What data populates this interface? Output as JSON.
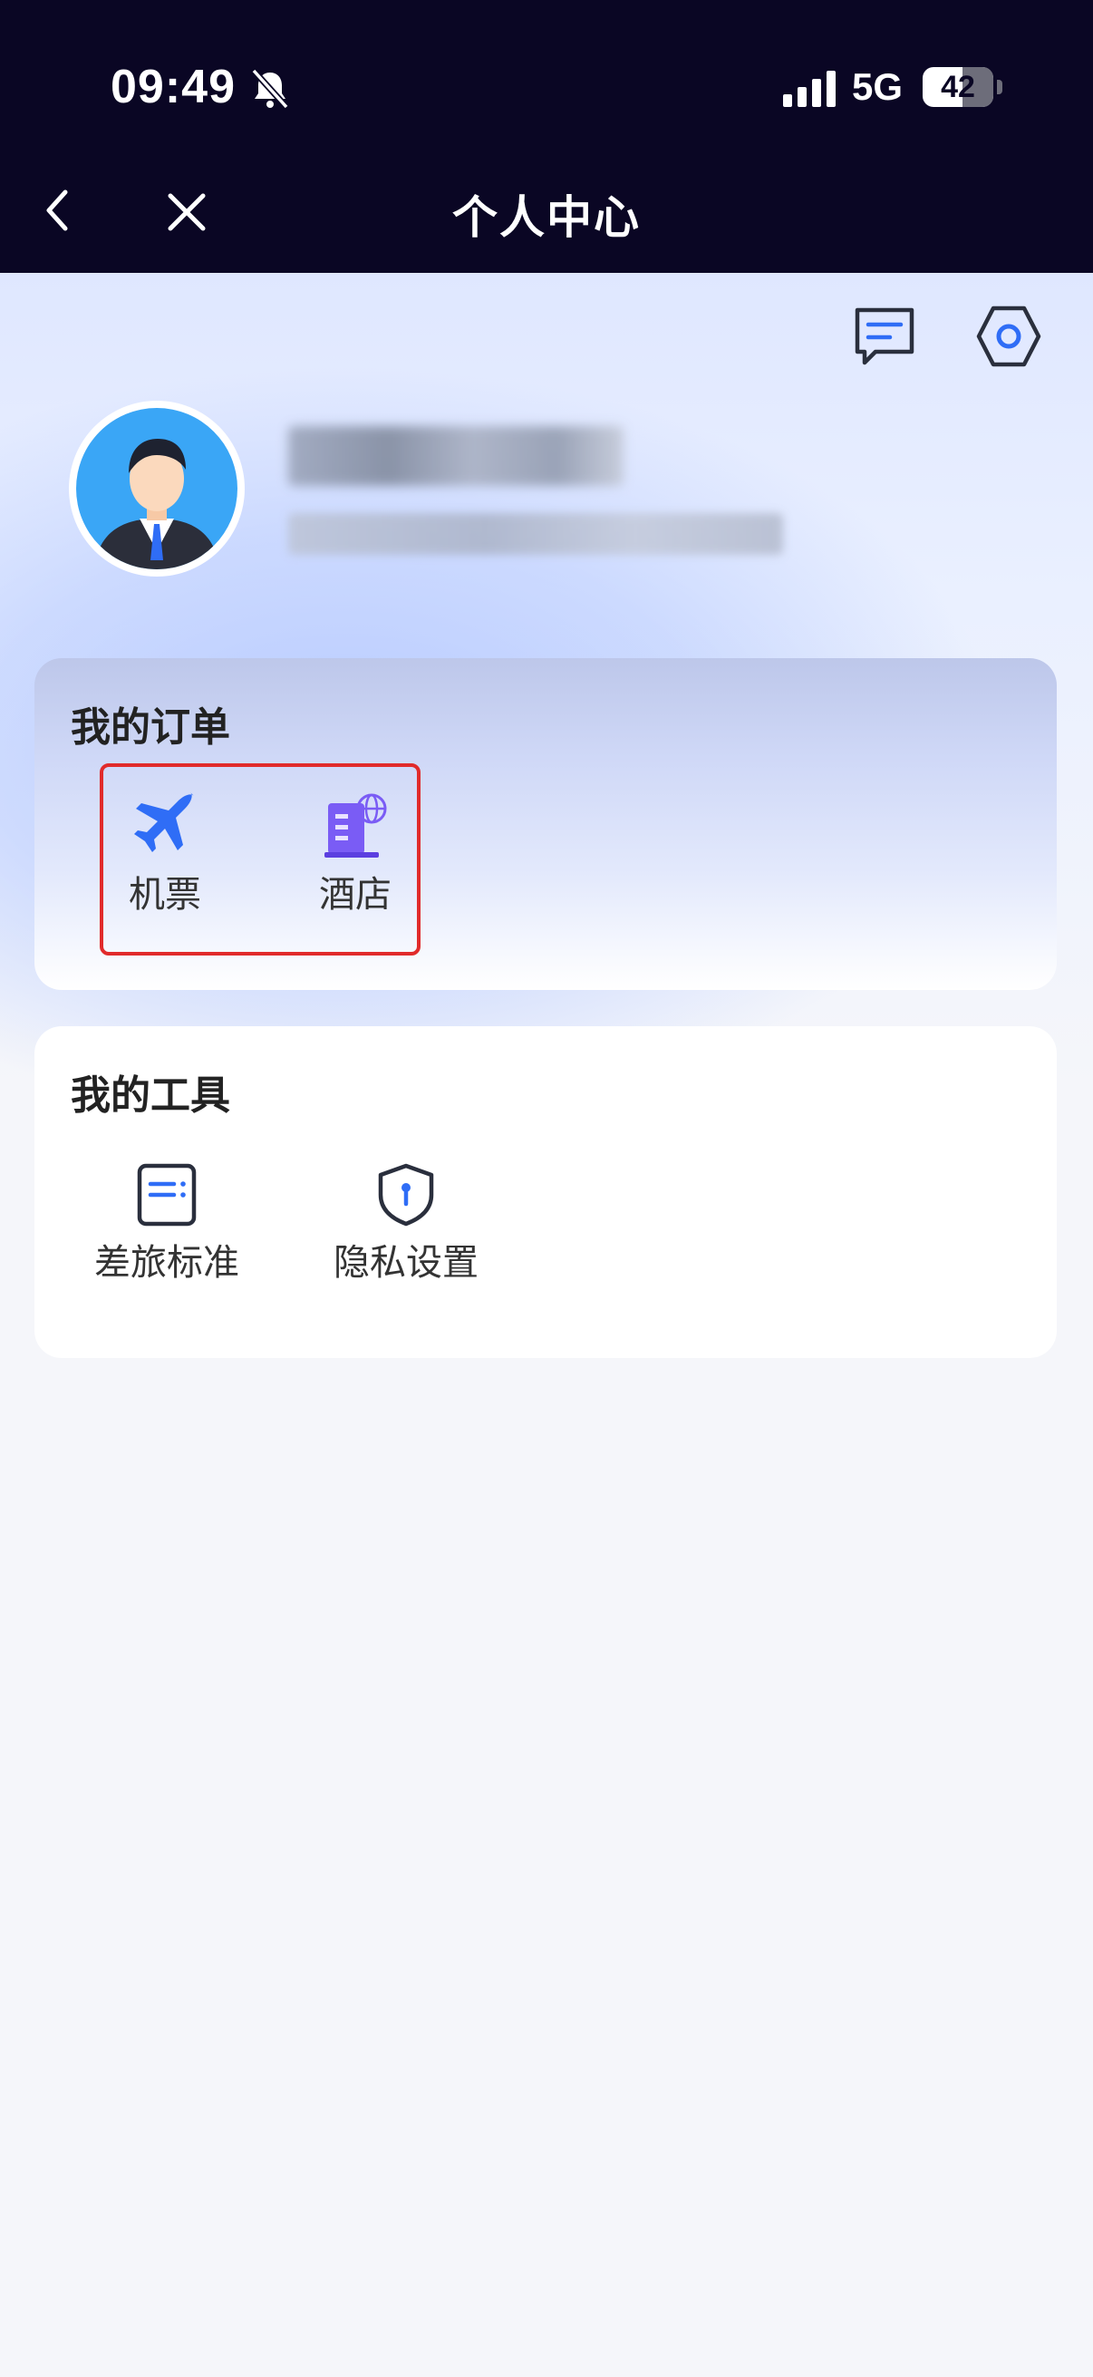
{
  "status_bar": {
    "time": "09:49",
    "network": "5G",
    "battery": "42"
  },
  "nav": {
    "title": "个人中心"
  },
  "orders": {
    "title": "我的订单",
    "items": [
      {
        "label": "机票",
        "icon": "airplane-icon"
      },
      {
        "label": "酒店",
        "icon": "hotel-icon"
      }
    ]
  },
  "tools": {
    "title": "我的工具",
    "items": [
      {
        "label": "差旅标准",
        "icon": "travel-policy-icon"
      },
      {
        "label": "隐私设置",
        "icon": "privacy-shield-icon"
      }
    ]
  },
  "colors": {
    "header_bg": "#0a0624",
    "accent_blue": "#2f6df6",
    "highlight_red": "#e12b2b"
  }
}
